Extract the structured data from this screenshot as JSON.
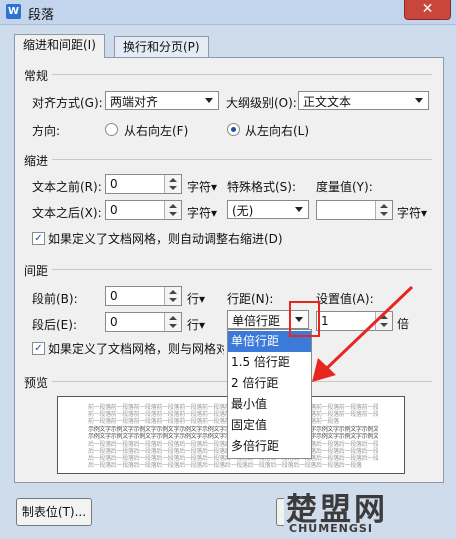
{
  "window": {
    "app_icon": "W",
    "title": "段落",
    "close": "✕"
  },
  "tabs": [
    {
      "label": "缩进和间距(I)",
      "active": true
    },
    {
      "label": "换行和分页(P)",
      "active": false
    }
  ],
  "general": {
    "section": "常规",
    "align_label": "对齐方式(G):",
    "align_value": "两端对齐",
    "outline_label": "大纲级别(O):",
    "outline_value": "正文文本",
    "direction_label": "方向:",
    "rtl_label": "从右向左(F)",
    "ltr_label": "从左向右(L)"
  },
  "indent": {
    "section": "缩进",
    "before_label": "文本之前(R):",
    "before_value": "0",
    "before_unit": "字符▾",
    "special_label": "特殊格式(S):",
    "special_value": "(无)",
    "measure_label": "度量值(Y):",
    "measure_value": "",
    "measure_unit": "字符▾",
    "after_label": "文本之后(X):",
    "after_value": "0",
    "after_unit": "字符▾",
    "auto_adjust": "如果定义了文档网格，则自动调整右缩进(D)"
  },
  "spacing": {
    "section": "间距",
    "before_label": "段前(B):",
    "before_value": "0",
    "before_unit": "行▾",
    "line_spacing_label": "行距(N):",
    "line_spacing_value": "单倍行距",
    "set_value_label": "设置值(A):",
    "set_value": "1",
    "set_unit": "倍",
    "after_label": "段后(E):",
    "after_value": "0",
    "after_unit": "行▾",
    "grid_align": "如果定义了文档网格，则与网格对",
    "options": [
      "单倍行距",
      "1.5 倍行距",
      "2 倍行距",
      "最小值",
      "固定值",
      "多倍行距"
    ]
  },
  "preview": {
    "section": "预览",
    "lines": [
      "前一段落前一段落前一段落前一段落前一段落前一段落前一段落前一段落前一段落前一段落前一段落前一段落前一段落前一段落前一段落前一段落前一段落",
      "前一段落前一段落前一段落前一段落前一段落前一段落前一段落前一段落前一段落前一段落前一段落前一段落前一段落前一段落前一段落前一段落前一段落",
      "前一段落前一段落前一段落前一段落前一段落前一段落前一段落前一段落前一段落前一段落前一段落",
      "示例文字示例文字示例文字示例文字示例文字示例文字示例文字示例文字示例文字示例文字示例文字示例文字示例文字",
      "示例文字示例文字示例文字示例文字示例文字示例文字示例文字示例文字示例文字示例文字示例文字示例文字示例文字",
      "后一段落后一段落后一段落后一段落后一段落后一段落后一段落后一段落后一段落后一段落后一段落后一段落后一段落后一段落后一段落后一段落后一段落",
      "后一段落后一段落后一段落后一段落后一段落后一段落后一段落后一段落后一段落后一段落后一段落后一段落后一段落后一段落后一段落后一段落后一段落",
      "后一段落后一段落后一段落后一段落后一段落后一段落后一段落后一段落后一段落后一段落后一段落后一段落后一段落后一段落后一段落后一段落后一段落",
      "后一段落后一段落后一段落后一段落后一段落后一段落后一段落后一段落后一段落后一段落后一段落后一段落"
    ]
  },
  "footer": {
    "tabstops_button": "制表位(T)..."
  },
  "watermark": {
    "big": "楚盟网",
    "small": "CHUMENGSI"
  },
  "colors": {
    "highlight": "#3b7ad9",
    "annotation_red": "#e6261f",
    "close_red": "#c9463d"
  }
}
